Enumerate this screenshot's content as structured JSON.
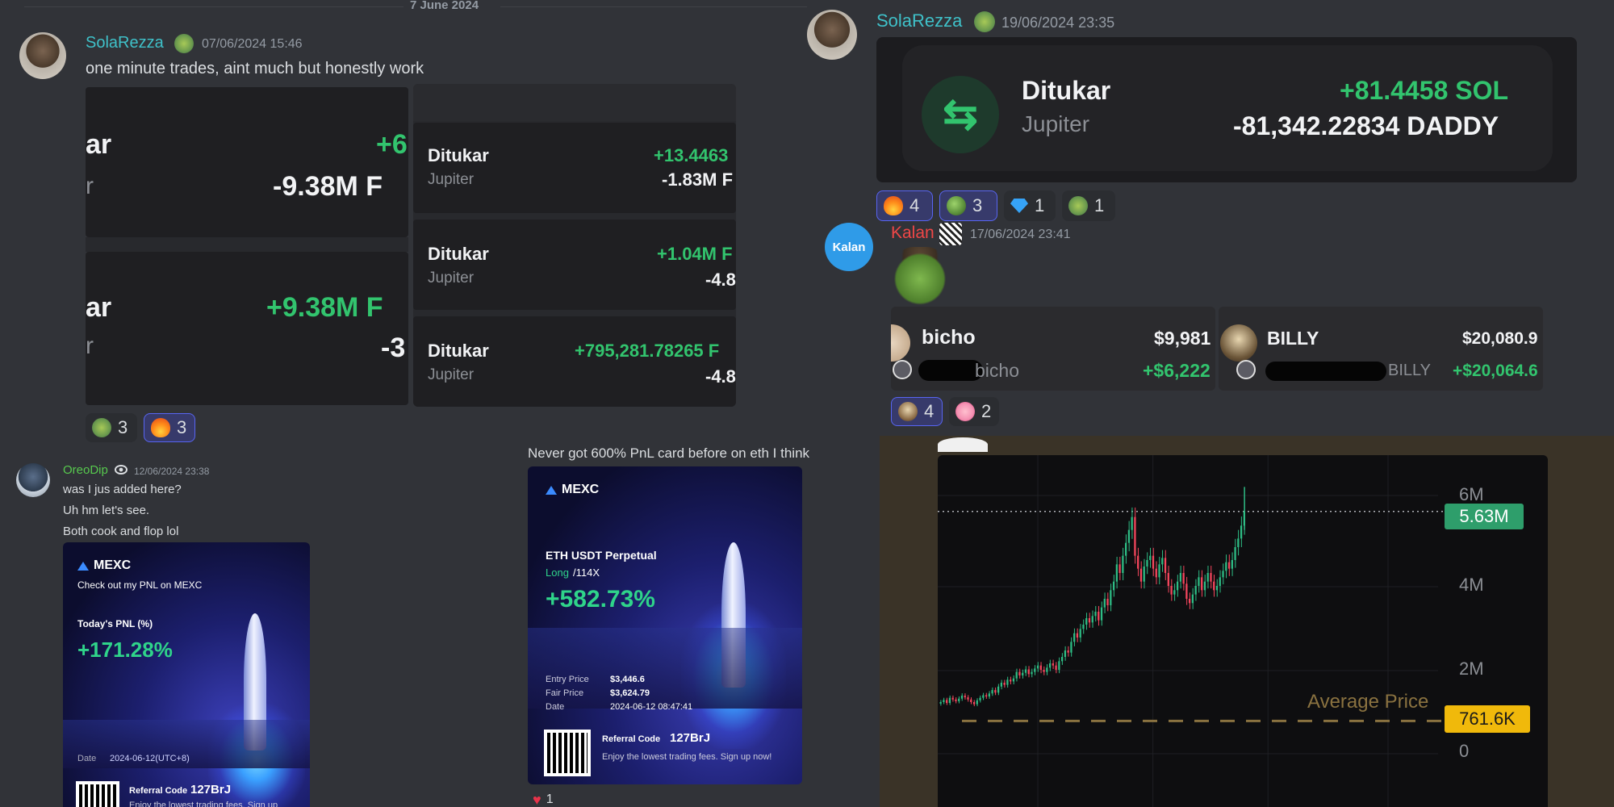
{
  "date_divider": "7 June 2024",
  "left_msg1": {
    "author": "SolaRezza",
    "timestamp": "07/06/2024 15:46",
    "text": "one minute trades, aint much but honestly work",
    "cards_left": [
      {
        "name": "ar",
        "sub": "r",
        "gain": "+6",
        "amount": "-9.38M F"
      },
      {
        "name": "ar",
        "sub": "r",
        "gain": "+9.38M F",
        "amount": "-3"
      }
    ],
    "cards_right": [
      {
        "name": "Ditukar",
        "sub": "Jupiter",
        "gain": "+13.4463",
        "amount": "-1.83M F"
      },
      {
        "name": "Ditukar",
        "sub": "Jupiter",
        "gain": "+1.04M F",
        "amount": "-4.8"
      },
      {
        "name": "Ditukar",
        "sub": "Jupiter",
        "gain": "+795,281.78265 F",
        "amount": "-4.8"
      }
    ],
    "reactions": [
      {
        "icon": "clover-emoji",
        "count": "3"
      },
      {
        "icon": "fire-emoji",
        "count": "3"
      }
    ]
  },
  "left_msg2": {
    "author": "OreoDip",
    "timestamp": "12/06/2024 23:38",
    "lines": [
      "was I jus added here?",
      "Uh hm let's see.",
      "Both cook and flop lol"
    ],
    "card": {
      "logo": "MEXC",
      "subtitle": "Check out my PNL on MEXC",
      "pnl_label": "Today's PNL (%)",
      "pnl_value": "+171.28%",
      "date_label": "Date",
      "date_value": "2024-06-12(UTC+8)",
      "referral_label": "Referral Code",
      "referral_code": "127BrJ",
      "referral_text": "Enjoy the lowest trading fees. Sign up"
    }
  },
  "left_msg3": {
    "text": "Never got 600% PnL card before on eth I think",
    "card": {
      "logo": "MEXC",
      "instrument": "ETH USDT Perpetual",
      "side": "Long",
      "leverage": "/114X",
      "pnl_value": "+582.73%",
      "entry_label": "Entry Price",
      "entry_value": "$3,446.6",
      "fair_label": "Fair Price",
      "fair_value": "$3,624.79",
      "date_label": "Date",
      "date_value": "2024-06-12 08:47:41",
      "referral_label": "Referral Code",
      "referral_code": "127BrJ",
      "referral_text": "Enjoy the lowest trading fees. Sign up now!"
    },
    "reactions": [
      {
        "icon": "heart-emoji",
        "count": "1"
      }
    ]
  },
  "right_msg1": {
    "author": "SolaRezza",
    "timestamp": "19/06/2024 23:35",
    "swap": {
      "name": "Ditukar",
      "sub": "Jupiter",
      "gain": "+81.4458 SOL",
      "amount": "-81,342.22834 DADDY"
    },
    "reactions": [
      {
        "icon": "fire-emoji",
        "count": "4"
      },
      {
        "icon": "pepe-emoji",
        "count": "3"
      },
      {
        "icon": "diamond-emoji",
        "count": "1"
      },
      {
        "icon": "clover-emoji",
        "count": "1"
      }
    ]
  },
  "right_msg2": {
    "author": "Kalan",
    "avatar_text": "Kalan",
    "timestamp": "17/06/2024 23:41",
    "tokens": [
      {
        "name": "bicho",
        "sub": "bicho",
        "value": "$9,981",
        "gain": "+$6,222"
      },
      {
        "name": "BILLY",
        "sub": "BILLY",
        "value": "$20,080.9",
        "gain": "+$20,064.6"
      }
    ],
    "reactions": [
      {
        "icon": "dog-emoji",
        "count": "4"
      },
      {
        "icon": "pig-emoji",
        "count": "2"
      }
    ]
  },
  "chart": {
    "price_label": "5.63M",
    "avg_label": "Average Price",
    "avg_value": "761.6K",
    "ticks": [
      "6M",
      "4M",
      "2M",
      "0"
    ]
  },
  "colors": {
    "bg": "#313338",
    "green": "#32c46e",
    "name_cyan": "#3fc1c9",
    "name_green": "#57f287",
    "name_pink": "#f04747",
    "price_tag": "#2e9e6b",
    "avg_tag": "#f0b90b"
  },
  "chart_data": {
    "type": "candlestick",
    "title": "",
    "ylabel": "",
    "ylim": [
      0,
      6500000
    ],
    "y_ticks": [
      "6M",
      "4M",
      "2M",
      "0"
    ],
    "last_price": "5.63M",
    "average_price": "761.6K",
    "close": [
      1200000,
      1250000,
      1180000,
      1300000,
      1260000,
      1220000,
      1280000,
      1350000,
      1310000,
      1260000,
      1200000,
      1150000,
      1240000,
      1300000,
      1360000,
      1330000,
      1400000,
      1480000,
      1420000,
      1560000,
      1650000,
      1600000,
      1720000,
      1680000,
      1750000,
      1900000,
      1820000,
      1880000,
      1960000,
      1850000,
      1900000,
      1980000,
      2050000,
      1950000,
      1900000,
      2000000,
      2100000,
      2050000,
      1950000,
      2150000,
      2250000,
      2400000,
      2350000,
      2600000,
      2800000,
      2700000,
      2900000,
      3000000,
      3150000,
      3050000,
      3200000,
      3300000,
      3100000,
      3400000,
      3600000,
      3450000,
      3800000,
      4000000,
      4400000,
      4200000,
      4600000,
      4900000,
      5200000,
      5500000,
      4600000,
      4300000,
      4000000,
      4350000,
      4500000,
      4600000,
      4300000,
      4100000,
      4400000,
      4550000,
      4200000,
      3900000,
      3700000,
      3800000,
      4000000,
      4200000,
      3950000,
      3600000,
      3500000,
      3700000,
      3900000,
      4100000,
      3800000,
      4000000,
      4200000,
      4000000,
      3800000,
      3900000,
      4100000,
      4250000,
      4450000,
      4300000,
      4500000,
      4800000,
      5000000,
      5300000,
      5630000
    ]
  }
}
